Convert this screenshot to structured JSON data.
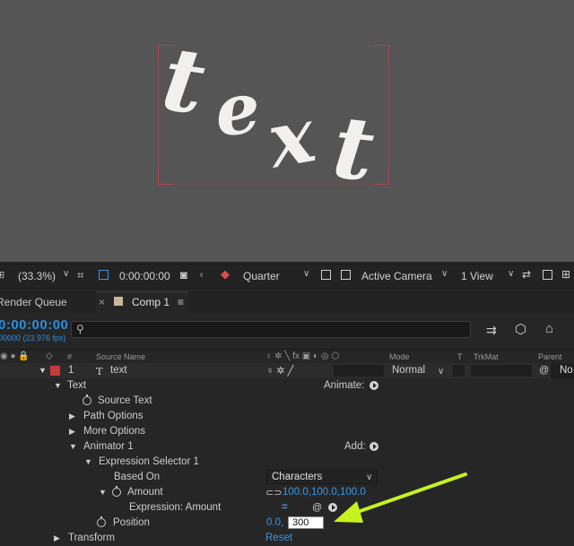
{
  "viewer": {
    "text_letters": [
      "t",
      "e",
      "x",
      "t"
    ],
    "bbox_color": "#b3434a"
  },
  "viewer_bar": {
    "zoom": "(33.3%)",
    "timecode": "0:00:00:00",
    "resolution": "Quarter",
    "camera": "Active Camera",
    "view": "1 View",
    "icons": [
      "grid-icon",
      "region-icon",
      "camera-snapshot-icon",
      "show-snapshot-icon",
      "color-channel-icon",
      "toggle-transparency-icon",
      "3d-view-icon",
      "layout-icon",
      "reset-exposure-icon",
      "flowchart-icon"
    ]
  },
  "tabs": {
    "render_queue": "Render Queue",
    "comp": "Comp 1",
    "close_glyph": "×",
    "menu_glyph": "≡"
  },
  "timeline": {
    "timecode": "0:00:00:00",
    "fps": "00000 (23.976 fps)",
    "search_placeholder": ""
  },
  "columns": {
    "num": "#",
    "source_name": "Source Name",
    "switches": "♀ ✲ ╲ fx ▣ ◐ ◎ ⬡",
    "mode": "Mode",
    "t": "T",
    "trkmat": "TrkMat",
    "parent": "Parent"
  },
  "layer": {
    "number": "1",
    "type_glyph": "T",
    "name": "text",
    "label_color": "#c33b3b",
    "mode": "Normal",
    "parent": "No"
  },
  "props": {
    "text": "Text",
    "animate": "Animate:",
    "source_text": "Source Text",
    "path_options": "Path Options",
    "more_options": "More Options",
    "animator": "Animator 1",
    "add": "Add:",
    "expression_selector": "Expression Selector 1",
    "based_on": "Based On",
    "based_on_value": "Characters",
    "amount": "Amount",
    "amount_value": "100.0,100.0,100.0",
    "expression_amount": "Expression: Amount",
    "equals": "=",
    "position": "Position",
    "position_x": "0.0,",
    "position_y": "300",
    "transform": "Transform",
    "reset": "Reset"
  },
  "accent_color": "#3a97e6",
  "arrow_color": "#c6f21f"
}
